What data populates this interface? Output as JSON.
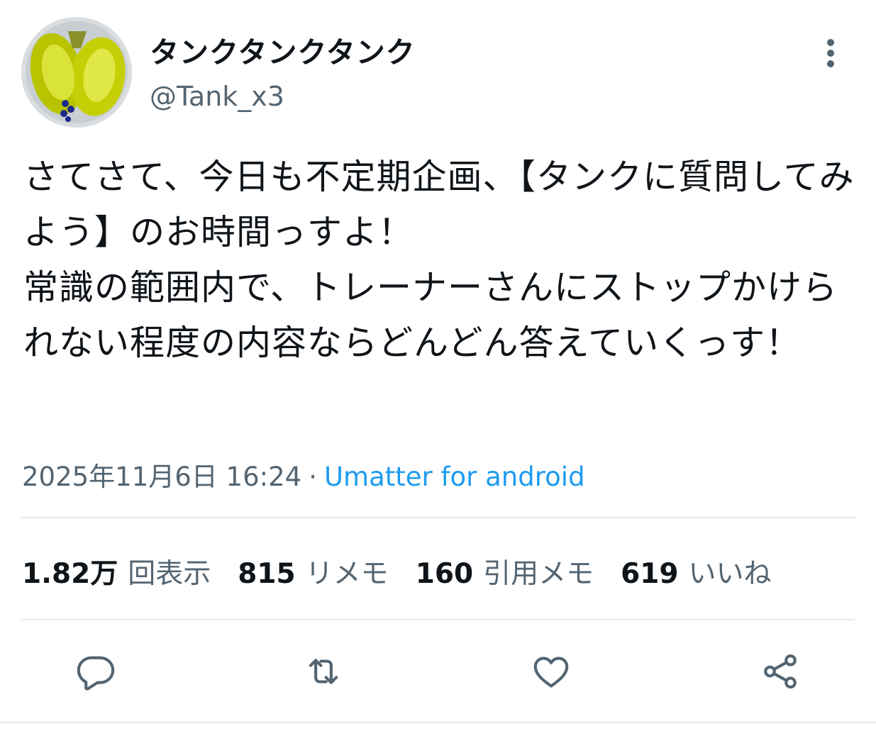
{
  "user": {
    "display_name": "タンクタンクタンク",
    "handle": "@Tank_x3"
  },
  "tweet": {
    "text": "さてさて、今日も不定期企画、【タンクに質問してみよう】のお時間っすよ！\n常識の範囲内で、トレーナーさんにストップかけられない程度の内容ならどんどん答えていくっす！",
    "timestamp": "2025年11月6日 16:24",
    "separator": "·",
    "source": "Umatter for android"
  },
  "stats": {
    "views_num": "1.82万",
    "views_label": "回表示",
    "rememe_num": "815",
    "rememe_label": "リメモ",
    "quote_num": "160",
    "quote_label": "引用メモ",
    "likes_num": "619",
    "likes_label": "いいね"
  },
  "icons": {
    "more": "more-vertical-icon",
    "reply": "reply-icon",
    "repost": "repost-icon",
    "like": "heart-icon",
    "share": "share-icon"
  },
  "colors": {
    "text": "#0f1419",
    "secondary": "#536471",
    "link": "#1d9bf0",
    "divider": "#e7e9ea"
  }
}
